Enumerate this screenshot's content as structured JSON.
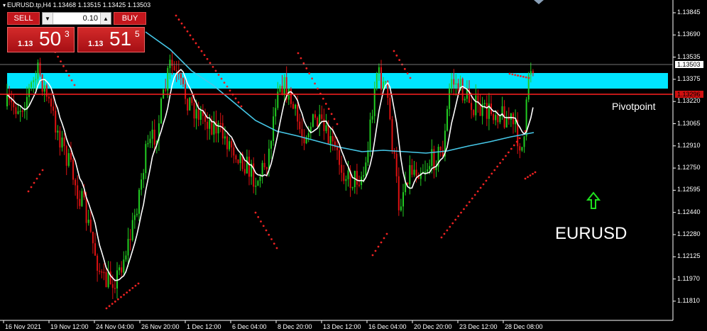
{
  "header": {
    "info": "EURUSD.tp,H4  1.13468 1.13515 1.13425 1.13503"
  },
  "trade_panel": {
    "sell_label": "SELL",
    "buy_label": "BUY",
    "lot_value": "0.10",
    "sell_price": {
      "prefix": "1.13",
      "big": "50",
      "sup": "3"
    },
    "buy_price": {
      "prefix": "1.13",
      "big": "51",
      "sup": "5"
    }
  },
  "colors": {
    "background": "#000000",
    "bull_candle": "#22cc22",
    "bear_candle": "#dd1111",
    "zone": "#00e5ff",
    "pivot_line": "#ff2020",
    "slow_ma": "#46c8e8",
    "fast_ma": "#ffffff",
    "sar_dots": "#ee2222"
  },
  "price_axis": {
    "ticks": [
      "1.13845",
      "1.13690",
      "1.13535",
      "1.13375",
      "1.13220",
      "1.13065",
      "1.12910",
      "1.12750",
      "1.12595",
      "1.12440",
      "1.12280",
      "1.12125",
      "1.11970",
      "1.11810"
    ],
    "current_price": "1.13503",
    "pivot_price": "1.13296"
  },
  "time_axis": {
    "ticks": [
      "16 Nov 2021",
      "19 Nov 12:00",
      "24 Nov 04:00",
      "26 Nov 20:00",
      "1 Dec 12:00",
      "6 Dec 04:00",
      "8 Dec 20:00",
      "13 Dec 12:00",
      "16 Dec 04:00",
      "20 Dec 20:00",
      "23 Dec 12:00",
      "28 Dec 08:00"
    ]
  },
  "annotations": {
    "pivot_label": "Pivotpoint",
    "symbol_label": "EURUSD",
    "arrow": "up-arrow-icon"
  }
}
